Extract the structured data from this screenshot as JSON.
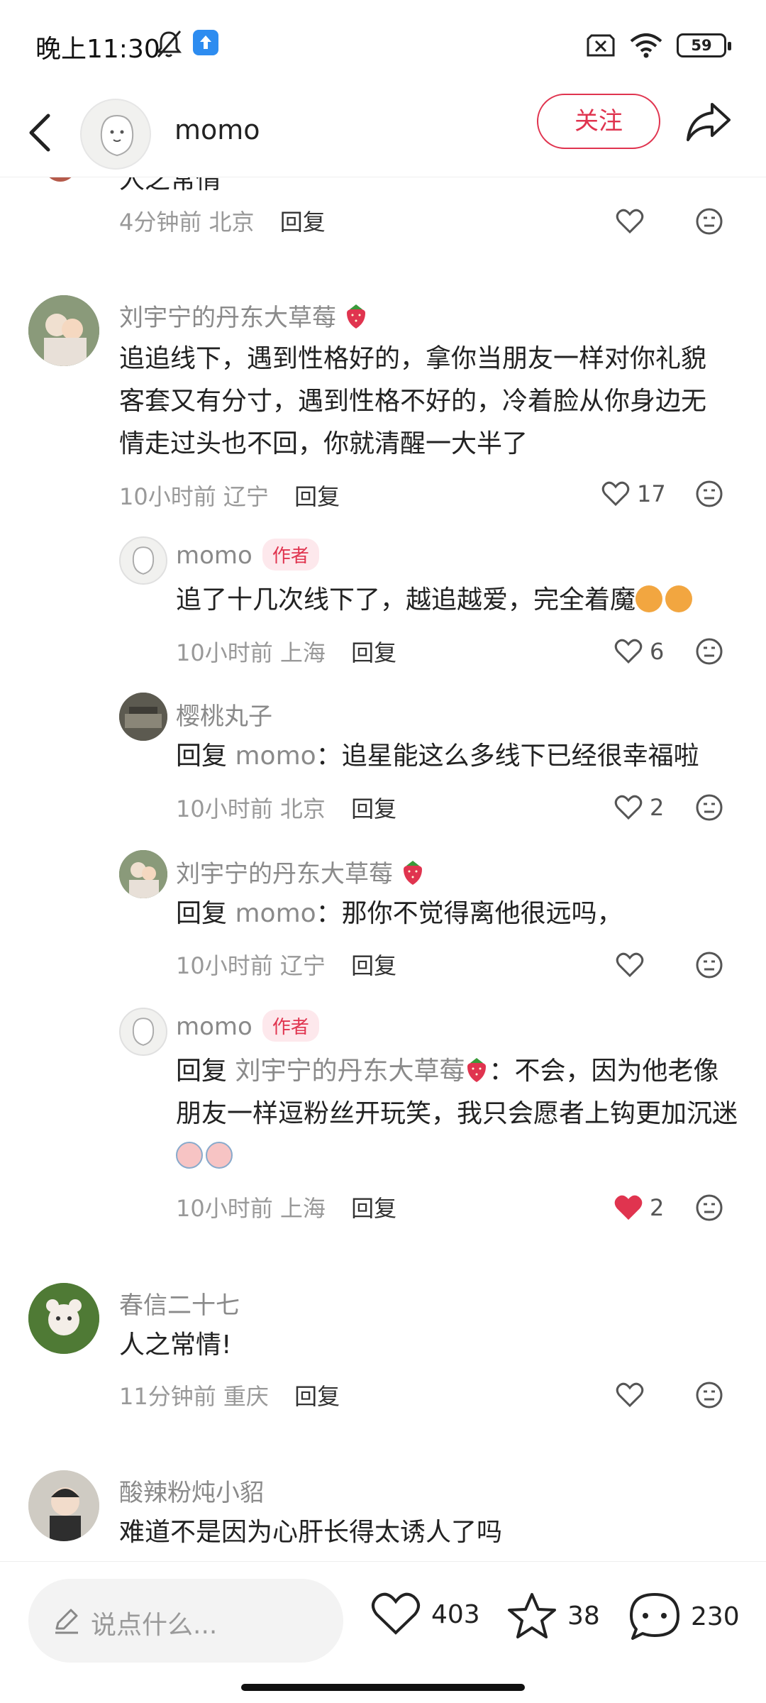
{
  "status_bar": {
    "time": "晚上11:30",
    "battery": "59"
  },
  "header": {
    "username": "momo",
    "follow_label": "关注"
  },
  "clipped_comment": {
    "text": "人之常情",
    "time": "4分钟前",
    "location": "北京",
    "reply_label": "回复"
  },
  "comments": [
    {
      "name": "刘宇宁的丹东大草莓",
      "text": "追追线下，遇到性格好的，拿你当朋友一样对你礼貌客套又有分寸，遇到性格不好的，冷着脸从你身边无情走过头也不回，你就清醒一大半了",
      "time": "10小时前",
      "location": "辽宁",
      "reply_label": "回复",
      "likes": "17",
      "replies": [
        {
          "name": "momo",
          "tag": "作者",
          "text": "追了十几次线下了，越追越爱，完全着魔",
          "time": "10小时前",
          "location": "上海",
          "reply_label": "回复",
          "likes": "6"
        },
        {
          "name": "樱桃丸子",
          "reply_prefix": "回复",
          "reply_to": "momo",
          "text": "：追星能这么多线下已经很幸福啦",
          "time": "10小时前",
          "location": "北京",
          "reply_label": "回复",
          "likes": "2"
        },
        {
          "name": "刘宇宁的丹东大草莓",
          "reply_prefix": "回复",
          "reply_to": "momo",
          "text": "：那你不觉得离他很远吗，",
          "time": "10小时前",
          "location": "辽宁",
          "reply_label": "回复",
          "likes": ""
        },
        {
          "name": "momo",
          "tag": "作者",
          "reply_prefix": "回复",
          "reply_to": "刘宇宁的丹东大草莓",
          "text": "：不会，因为他老像朋友一样逗粉丝开玩笑，我只会愿者上钩更加沉迷",
          "time": "10小时前",
          "location": "上海",
          "reply_label": "回复",
          "likes": "2",
          "liked": true
        }
      ]
    },
    {
      "name": "春信二十七",
      "text": "人之常情!",
      "time": "11分钟前",
      "location": "重庆",
      "reply_label": "回复",
      "likes": ""
    },
    {
      "name": "酸辣粉炖小貂",
      "text": "难道不是因为心肝长得太诱人了吗"
    }
  ],
  "bottom_bar": {
    "input_placeholder": "说点什么...",
    "likes": "403",
    "stars": "38",
    "comments": "230"
  },
  "colors": {
    "accent": "#e0344f",
    "meta_gray": "#999999",
    "name_gray": "#8a8a8a"
  }
}
